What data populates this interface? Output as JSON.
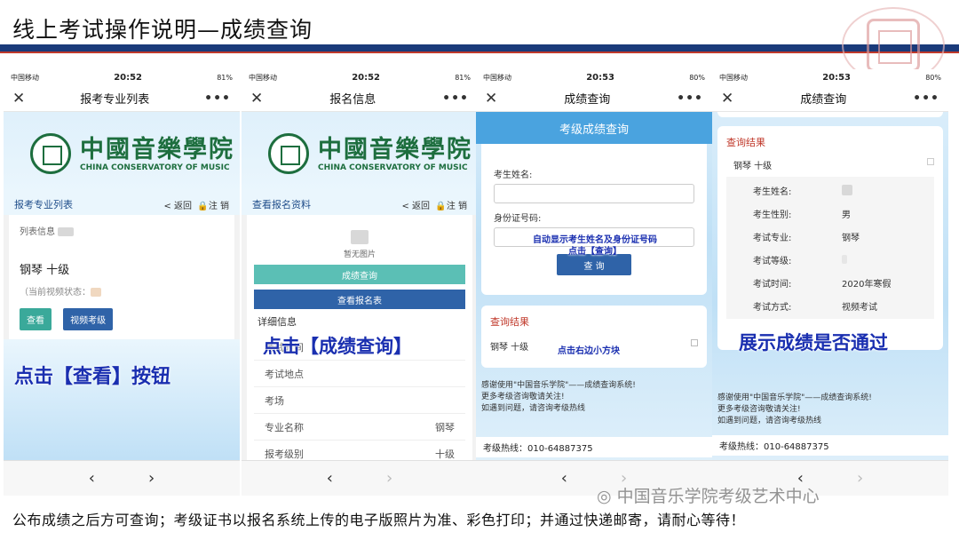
{
  "slide": {
    "title": "线上考试操作说明—成绩查询",
    "bottom_text": "公布成绩之后方可查询；考级证书以报名系统上传的电子版照片为准、彩色打印；并通过快递邮寄，请耐心等待！",
    "watermark": "中国音乐学院考级艺术中心"
  },
  "status": {
    "carrier": "中国移动",
    "time1": "20:52",
    "time2": "20:52",
    "time3": "20:53",
    "time4": "20:53",
    "battery1": "81%",
    "battery2": "81%",
    "battery3": "80%",
    "battery4": "80%"
  },
  "nav": {
    "close": "✕",
    "more": "•••"
  },
  "logo": {
    "cn": "中國音樂學院",
    "en": "CHINA CONSERVATORY OF MUSIC"
  },
  "phone1": {
    "nav_title": "报考专业列表",
    "sub_left": "报考专业列表",
    "sub_back": "< 返回",
    "sub_logout": "注 销",
    "list_info": "列表信息",
    "major": "钢琴  十级",
    "video_status": "（当前视频状态：",
    "btn_view": "查看",
    "btn_video": "视频考级",
    "annotation": "点击【查看】按钮",
    "prev": "‹",
    "next": "›"
  },
  "phone2": {
    "nav_title": "报名信息",
    "sub_left": "查看报名资料",
    "sub_back": "< 返回",
    "sub_logout": "注 销",
    "no_image": "暂无图片",
    "btn_score": "成绩查询",
    "btn_form": "查看报名表",
    "detail": "详细信息",
    "rows": [
      {
        "k": "考试时间",
        "v": ""
      },
      {
        "k": "考试地点",
        "v": ""
      },
      {
        "k": "考场",
        "v": ""
      },
      {
        "k": "专业名称",
        "v": "钢琴"
      },
      {
        "k": "报考级别",
        "v": "十级"
      }
    ],
    "annotation": "点击【成绩查询】",
    "prev": "‹",
    "next": "›"
  },
  "phone3": {
    "nav_title": "成绩查询",
    "header": "考级成绩查询",
    "label_name": "考生姓名:",
    "label_id": "身份证号码:",
    "hint1": "自动显示考生姓名及身份证号码",
    "hint2": "点击【查询】",
    "btn_query": "查  询",
    "result_title": "查询结果",
    "result_item": "钢琴  十级",
    "result_hint": "点击右边小方块",
    "thanks1": "感谢使用\"中国音乐学院\"——成绩查询系统!",
    "thanks2": "更多考级咨询敬请关注!",
    "thanks3": "如遇到问题，请咨询考级热线",
    "hotline": "考级热线：010-64887375",
    "prev": "‹",
    "next": "›"
  },
  "phone4": {
    "nav_title": "成绩查询",
    "result_title": "查询结果",
    "result_item": "钢琴  十级",
    "rows": [
      {
        "k": "考生姓名:",
        "v": ""
      },
      {
        "k": "考生性别:",
        "v": "男"
      },
      {
        "k": "考试专业:",
        "v": "钢琴"
      },
      {
        "k": "考试等级:",
        "v": ""
      },
      {
        "k": "考试时间:",
        "v": "2020年寒假"
      },
      {
        "k": "考试方式:",
        "v": "视频考试"
      }
    ],
    "annotation": "展示成绩是否通过",
    "thanks1": "感谢使用\"中国音乐学院\"——成绩查询系统!",
    "thanks2": "更多考级咨询敬请关注!",
    "thanks3": "如遇到问题，请咨询考级热线",
    "hotline": "考级热线：010-64887375",
    "prev": "‹",
    "next": "›"
  }
}
